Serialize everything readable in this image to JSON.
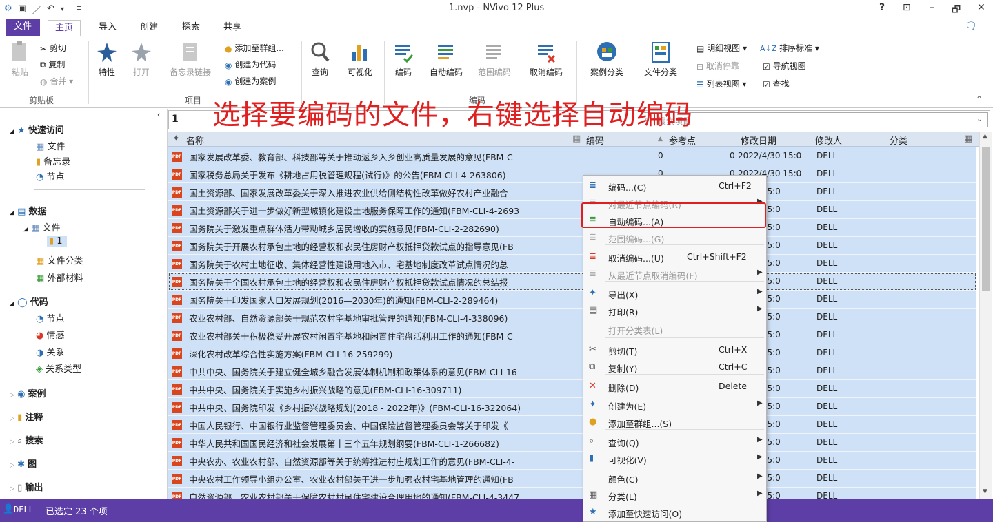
{
  "window": {
    "title": "1.nvp - NVivo 12 Plus",
    "help": "?",
    "wc_restore_ribbon": "⊡",
    "wc_min": "–",
    "wc_max": "🗗",
    "wc_close": "✕"
  },
  "menu_tabs": [
    "文件",
    "主页",
    "导入",
    "创建",
    "探索",
    "共享"
  ],
  "ribbon": {
    "paste": "粘贴",
    "cut": "剪切",
    "copy": "复制",
    "merge": "合并",
    "clipboard_group": "剪贴板",
    "properties": "特性",
    "open": "打开",
    "memo_link": "备忘录链接",
    "add_to_group": "添加至群组...",
    "create_as_code": "创建为代码",
    "create_as_case": "创建为案例",
    "item_group": "项目",
    "query": "查询",
    "visualize": "可视化",
    "code": "编码",
    "auto_code": "自动编码",
    "range_code": "范围编码",
    "uncode": "取消编码",
    "code_group": "编码",
    "case_classify": "案例分类",
    "file_classify": "文件分类",
    "detail_view": "明细视图",
    "sort_by": "排序标准",
    "undock": "取消停靠",
    "nav_view": "导航视图",
    "list_view": "列表视图",
    "find": "查找"
  },
  "annotation": "选择要编码的文件，右键选择自动编码",
  "sidebar": {
    "quick_access": "快速访问",
    "qa_files": "文件",
    "qa_memos": "备忘录",
    "qa_nodes": "节点",
    "data": "数据",
    "files": "文件",
    "folder_1": "1",
    "file_class": "文件分类",
    "externals": "外部材料",
    "codes": "代码",
    "nodes": "节点",
    "sentiment": "情感",
    "relations": "关系",
    "relation_types": "关系类型",
    "cases": "案例",
    "notes": "注释",
    "search": "搜索",
    "maps": "图",
    "output": "输出"
  },
  "path": "1",
  "search": {
    "placeholder": "搜索项目"
  },
  "columns": {
    "name": "名称",
    "codes": "编码",
    "refs": "参考点",
    "modified": "修改日期",
    "modified_by": "修改人",
    "classification": "分类"
  },
  "files": [
    {
      "name": "国家发展改革委、教育部、科技部等关于推动返乡入乡创业高质量发展的意见(FBM-C",
      "codes": "0",
      "refs": "0",
      "date": "2022/4/30 15:0",
      "by": "DELL"
    },
    {
      "name": "国家税务总局关于发布《耕地占用税管理规程(试行)》的公告(FBM-CLI-4-263806)",
      "codes": "0",
      "refs": "0",
      "date": "2022/4/30 15:0",
      "by": "DELL"
    },
    {
      "name": "国土资源部、国家发展改革委关于深入推进农业供给侧结构性改革做好农村产业融合",
      "codes": "",
      "refs": "",
      "date": "/4/30 15:0",
      "by": "DELL"
    },
    {
      "name": "国土资源部关于进一步做好新型城镇化建设土地服务保障工作的通知(FBM-CLI-4-2693",
      "codes": "",
      "refs": "",
      "date": "/4/30 15:0",
      "by": "DELL"
    },
    {
      "name": "国务院关于激发重点群体活力带动城乡居民增收的实施意见(FBM-CLI-2-282690)",
      "codes": "",
      "refs": "",
      "date": "/4/30 15:0",
      "by": "DELL"
    },
    {
      "name": "国务院关于开展农村承包土地的经营权和农民住房财产权抵押贷款试点的指导意见(FB",
      "codes": "",
      "refs": "",
      "date": "/4/30 15:0",
      "by": "DELL"
    },
    {
      "name": "国务院关于农村土地征收、集体经营性建设用地入市、宅基地制度改革试点情况的总",
      "codes": "",
      "refs": "",
      "date": "/4/30 15:0",
      "by": "DELL"
    },
    {
      "name": "国务院关于全国农村承包土地的经营权和农民住房财产权抵押贷款试点情况的总结报",
      "codes": "",
      "refs": "",
      "date": "/4/30 15:0",
      "by": "DELL"
    },
    {
      "name": "国务院关于印发国家人口发展规划(2016—2030年)的通知(FBM-CLI-2-289464)",
      "codes": "",
      "refs": "",
      "date": "/4/30 15:0",
      "by": "DELL"
    },
    {
      "name": "农业农村部、自然资源部关于规范农村宅基地审批管理的通知(FBM-CLI-4-338096)",
      "codes": "",
      "refs": "",
      "date": "/4/30 15:0",
      "by": "DELL"
    },
    {
      "name": "农业农村部关于积极稳妥开展农村闲置宅基地和闲置住宅盘活利用工作的通知(FBM-C",
      "codes": "",
      "refs": "",
      "date": "/4/30 15:0",
      "by": "DELL"
    },
    {
      "name": "深化农村改革综合性实施方案(FBM-CLI-16-259299)",
      "codes": "",
      "refs": "",
      "date": "/4/30 15:0",
      "by": "DELL"
    },
    {
      "name": "中共中央、国务院关于建立健全城乡融合发展体制机制和政策体系的意见(FBM-CLI-16",
      "codes": "",
      "refs": "",
      "date": "/4/30 15:0",
      "by": "DELL"
    },
    {
      "name": "中共中央、国务院关于实施乡村振兴战略的意见(FBM-CLI-16-309711)",
      "codes": "",
      "refs": "",
      "date": "/4/30 15:0",
      "by": "DELL"
    },
    {
      "name": "中共中央、国务院印发《乡村振兴战略规划(2018 - 2022年)》(FBM-CLI-16-322064)",
      "codes": "",
      "refs": "",
      "date": "/4/30 15:0",
      "by": "DELL"
    },
    {
      "name": "中国人民银行、中国银行业监督管理委员会、中国保险监督管理委员会等关于印发《",
      "codes": "",
      "refs": "",
      "date": "/4/30 15:0",
      "by": "DELL"
    },
    {
      "name": "中华人民共和国国民经济和社会发展第十三个五年规划纲要(FBM-CLI-1-266682)",
      "codes": "",
      "refs": "",
      "date": "/4/30 15:0",
      "by": "DELL"
    },
    {
      "name": "中央农办、农业农村部、自然资源部等关于统筹推进村庄规划工作的意见(FBM-CLI-4-",
      "codes": "",
      "refs": "",
      "date": "/4/30 15:0",
      "by": "DELL"
    },
    {
      "name": "中央农村工作领导小组办公室、农业农村部关于进一步加强农村宅基地管理的通知(FB",
      "codes": "",
      "refs": "",
      "date": "/4/30 15:0",
      "by": "DELL"
    },
    {
      "name": "自然资源部、农业农村部关于保障农村村民住宅建设合理用地的通知(FBM-CLI-4-3447",
      "codes": "",
      "refs": "",
      "date": "/4/30 15:0",
      "by": "DELL"
    }
  ],
  "context_menu": [
    {
      "label": "编码...(C)",
      "shortcut": "Ctrl+F2",
      "disabled": false
    },
    {
      "label": "对最近节点编码(R)",
      "shortcut": "",
      "disabled": true
    },
    {
      "label": "自动编码...(A)",
      "shortcut": "",
      "disabled": false
    },
    {
      "label": "范围编码...(G)",
      "shortcut": "",
      "disabled": true
    },
    {
      "label": "取消编码...(U)",
      "shortcut": "Ctrl+Shift+F2",
      "disabled": false
    },
    {
      "label": "从最近节点取消编码(F)",
      "shortcut": "",
      "disabled": true
    },
    {
      "label": "导出(X)",
      "shortcut": "",
      "disabled": false
    },
    {
      "label": "打印(R)",
      "shortcut": "",
      "disabled": false
    },
    {
      "label": "打开分类表(L)",
      "shortcut": "",
      "disabled": true
    },
    {
      "label": "剪切(T)",
      "shortcut": "Ctrl+X",
      "disabled": false
    },
    {
      "label": "复制(Y)",
      "shortcut": "Ctrl+C",
      "disabled": false
    },
    {
      "label": "删除(D)",
      "shortcut": "Delete",
      "disabled": false
    },
    {
      "label": "创建为(E)",
      "shortcut": "",
      "disabled": false
    },
    {
      "label": "添加至群组...(S)",
      "shortcut": "",
      "disabled": false
    },
    {
      "label": "查询(Q)",
      "shortcut": "",
      "disabled": false
    },
    {
      "label": "可视化(V)",
      "shortcut": "",
      "disabled": false
    },
    {
      "label": "颜色(C)",
      "shortcut": "",
      "disabled": false
    },
    {
      "label": "分类(L)",
      "shortcut": "",
      "disabled": false
    },
    {
      "label": "添加至快速访问(O)",
      "shortcut": "",
      "disabled": false
    }
  ],
  "status": {
    "user": "DELL",
    "selection": "已选定 23 个项"
  },
  "colors": {
    "accent": "#5c3ea6",
    "selection": "#cfe1f7",
    "highlight": "#e02020"
  }
}
